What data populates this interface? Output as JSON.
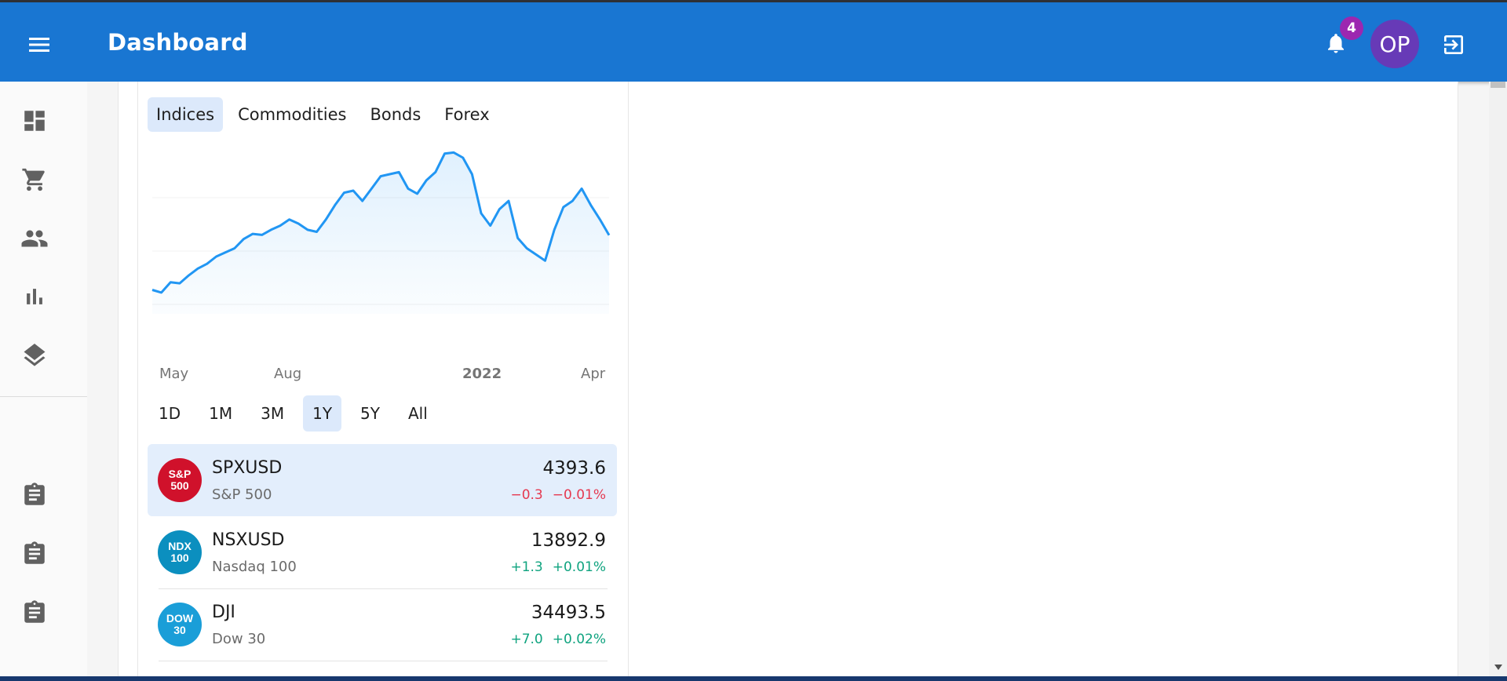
{
  "header": {
    "title": "Dashboard",
    "notification_count": "4",
    "avatar_initials": "OP",
    "menu_icon": "menu-icon",
    "bell_icon": "bell-icon",
    "logout_icon": "logout-icon",
    "background_color": "#1976d2"
  },
  "sidebar": {
    "items": [
      {
        "icon": "dashboard-icon"
      },
      {
        "icon": "shopping-cart-icon"
      },
      {
        "icon": "people-icon"
      },
      {
        "icon": "bar-chart-icon"
      },
      {
        "icon": "layers-icon"
      }
    ],
    "secondary_items": [
      {
        "icon": "assignment-icon"
      },
      {
        "icon": "assignment-icon"
      },
      {
        "icon": "assignment-icon"
      }
    ]
  },
  "market": {
    "tabs": [
      "Indices",
      "Commodities",
      "Bonds",
      "Forex"
    ],
    "active_tab": "Indices",
    "ranges": [
      "1D",
      "1M",
      "3M",
      "1Y",
      "5Y",
      "All"
    ],
    "active_range": "1Y",
    "instruments": [
      {
        "logo": "S&P\n500",
        "logo_color": "#d0112b",
        "symbol": "SPXUSD",
        "name": "S&P 500",
        "price": "4393.6",
        "change": "−0.3",
        "change_pct": "−0.01%",
        "direction": "down"
      },
      {
        "logo": "NDX\n100",
        "logo_color": "#0b8fbf",
        "symbol": "NSXUSD",
        "name": "Nasdaq 100",
        "price": "13892.9",
        "change": "+1.3",
        "change_pct": "+0.01%",
        "direction": "up"
      },
      {
        "logo": "DOW\n30",
        "logo_color": "#1a9ed8",
        "symbol": "DJI",
        "name": "Dow 30",
        "price": "34493.5",
        "change": "+7.0",
        "change_pct": "+0.02%",
        "direction": "up"
      }
    ],
    "up_color": "#0fa37f",
    "down_color": "#e53950"
  },
  "chart_data": {
    "type": "area",
    "line_color": "#2196f3",
    "x_tick_labels": [
      "May",
      "Aug",
      "2022",
      "Apr"
    ],
    "x": [
      0,
      2,
      4,
      6,
      8,
      10,
      12,
      14,
      16,
      18,
      20,
      22,
      24,
      26,
      28,
      30,
      32,
      34,
      36,
      38,
      40,
      42,
      44,
      46,
      48,
      50,
      52,
      54,
      56,
      58,
      60,
      62,
      64,
      66,
      68,
      70,
      72,
      74,
      76,
      78,
      80,
      82,
      84,
      86,
      88,
      90,
      92,
      94,
      96,
      98,
      100
    ],
    "values": [
      4128,
      4115,
      4165,
      4160,
      4199,
      4232,
      4255,
      4290,
      4310,
      4330,
      4375,
      4400,
      4395,
      4420,
      4440,
      4470,
      4450,
      4420,
      4410,
      4470,
      4540,
      4600,
      4610,
      4560,
      4620,
      4680,
      4690,
      4700,
      4620,
      4595,
      4660,
      4700,
      4790,
      4795,
      4770,
      4690,
      4500,
      4440,
      4520,
      4560,
      4380,
      4330,
      4300,
      4270,
      4420,
      4530,
      4560,
      4620,
      4540,
      4470,
      4393.6
    ],
    "y_range": [
      4050,
      4850
    ],
    "grid": "horizontal"
  }
}
